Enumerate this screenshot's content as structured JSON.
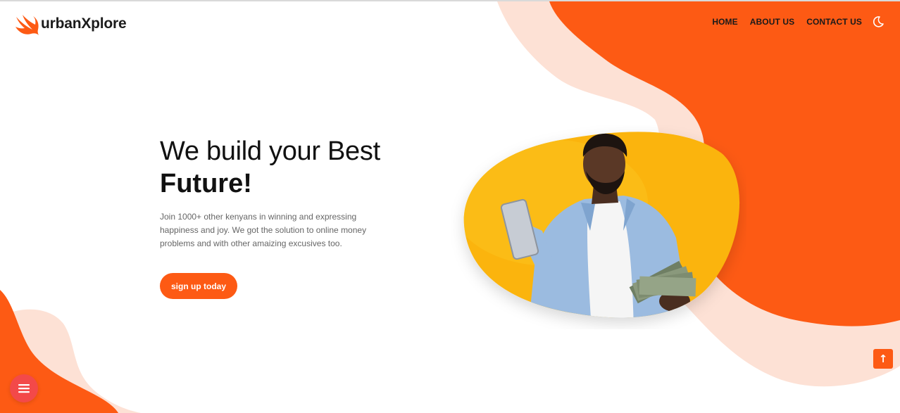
{
  "brand": {
    "name": "urbanXplore",
    "logo_icon": "swift-bird-icon",
    "accent_color": "#fd5a14",
    "peach_color": "#fde1d5"
  },
  "nav": {
    "items": [
      {
        "label": "HOME"
      },
      {
        "label": "ABOUT US"
      },
      {
        "label": "CONTACT US"
      }
    ],
    "theme_toggle_icon": "moon-icon"
  },
  "hero": {
    "title_line1": "We build your Best",
    "title_line2": "Future!",
    "description": "Join 1000+ other kenyans in winning and expressing happiness and joy. We got the solution to online money problems and with other amaizing excusives too.",
    "cta_label": "sign up today",
    "image_icon": "man-with-tablet-and-cash-photo",
    "image_blob_color": "#fbb40a"
  },
  "controls": {
    "scroll_top_icon": "arrow-up-icon",
    "menu_icon": "hamburger-menu-icon",
    "menu_button_color": "#f34949"
  }
}
